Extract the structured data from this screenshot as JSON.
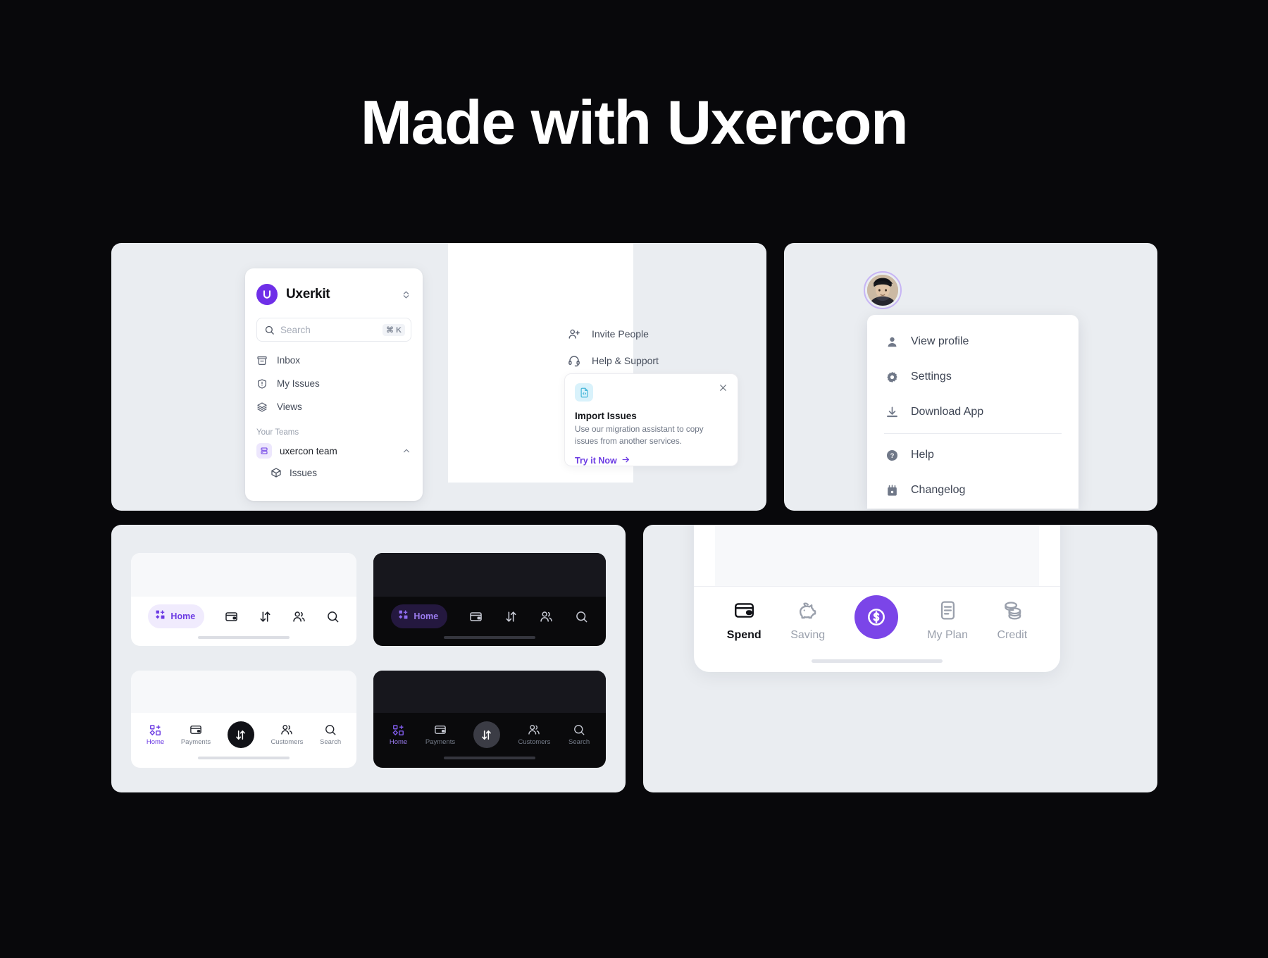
{
  "hero": {
    "title": "Made with Uxercon"
  },
  "colors": {
    "page_background": "#08080b",
    "card_background": "#eaedf1",
    "accent_purple": "#6b3ae3",
    "fab_purple": "#7b45e8",
    "dark_phone": "#0a0a0c"
  },
  "sidebar": {
    "brand": {
      "name": "Uxerkit",
      "logo_letter": "U",
      "switcher_icon": "chevron-up-down-icon"
    },
    "search": {
      "placeholder": "Search",
      "value": "",
      "shortcut": "⌘ K",
      "icon": "search-icon"
    },
    "nav": [
      {
        "label": "Inbox",
        "icon": "inbox-icon"
      },
      {
        "label": "My Issues",
        "icon": "shield-alert-icon"
      },
      {
        "label": "Views",
        "icon": "layers-icon"
      }
    ],
    "teams_label": "Your Teams",
    "team": {
      "label": "uxercon team",
      "icon": "server-icon",
      "chevron": "chevron-up-icon"
    },
    "team_children": [
      {
        "label": "Issues",
        "icon": "box-icon"
      }
    ]
  },
  "sidebar_footer": {
    "items": [
      {
        "label": "Invite People",
        "icon": "user-plus-icon"
      },
      {
        "label": "Help & Support",
        "icon": "headset-icon"
      }
    ]
  },
  "import_card": {
    "icon": "file-code-icon",
    "close_icon": "close-icon",
    "title": "Import Issues",
    "description": "Use our migration assistant to copy issues from another services.",
    "cta": "Try it Now",
    "cta_icon": "arrow-right-icon"
  },
  "profile_menu": {
    "avatar": "user-avatar",
    "items": [
      {
        "label": "View profile",
        "icon": "user-icon"
      },
      {
        "label": "Settings",
        "icon": "gear-icon"
      },
      {
        "label": "Download App",
        "icon": "download-icon"
      },
      {
        "label": "Help",
        "icon": "question-circle-icon"
      },
      {
        "label": "Changelog",
        "icon": "calendar-icon"
      }
    ],
    "separator_after_index": 2
  },
  "tabbars": {
    "pill_light": {
      "theme": "light",
      "active_label": "Home",
      "active_icon": "dashboard-icon",
      "items": [
        {
          "label": "Home",
          "icon": "dashboard-icon",
          "active": true
        },
        {
          "label": "Payments",
          "icon": "credit-card-icon",
          "active": false
        },
        {
          "label": "Transfer",
          "icon": "transfer-arrows-icon",
          "active": false
        },
        {
          "label": "Customers",
          "icon": "users-icon",
          "active": false
        },
        {
          "label": "Search",
          "icon": "search-icon",
          "active": false
        }
      ]
    },
    "pill_dark": {
      "theme": "dark",
      "active_label": "Home",
      "active_icon": "dashboard-icon",
      "items": [
        {
          "label": "Home",
          "icon": "dashboard-icon",
          "active": true
        },
        {
          "label": "Payments",
          "icon": "credit-card-icon",
          "active": false
        },
        {
          "label": "Transfer",
          "icon": "transfer-arrows-icon",
          "active": false
        },
        {
          "label": "Customers",
          "icon": "users-icon",
          "active": false
        },
        {
          "label": "Search",
          "icon": "search-icon",
          "active": false
        }
      ]
    },
    "labeled_light": {
      "theme": "light",
      "items": [
        {
          "label": "Home",
          "icon": "dashboard-icon",
          "active": true
        },
        {
          "label": "Payments",
          "icon": "credit-card-icon",
          "active": false
        },
        {
          "label": "",
          "icon": "transfer-arrows-icon",
          "active": false,
          "fab": true
        },
        {
          "label": "Customers",
          "icon": "users-icon",
          "active": false
        },
        {
          "label": "Search",
          "icon": "search-icon",
          "active": false
        }
      ]
    },
    "labeled_dark": {
      "theme": "dark",
      "items": [
        {
          "label": "Home",
          "icon": "dashboard-icon",
          "active": true
        },
        {
          "label": "Payments",
          "icon": "credit-card-icon",
          "active": false
        },
        {
          "label": "",
          "icon": "transfer-arrows-icon",
          "active": false,
          "fab": true
        },
        {
          "label": "Customers",
          "icon": "users-icon",
          "active": false
        },
        {
          "label": "Search",
          "icon": "search-icon",
          "active": false
        }
      ]
    },
    "finance": {
      "items": [
        {
          "label": "Spend",
          "icon": "credit-card-icon",
          "active": true
        },
        {
          "label": "Saving",
          "icon": "piggy-bank-icon",
          "active": false
        },
        {
          "label": "",
          "icon": "dollar-circle-icon",
          "active": false,
          "fab": true
        },
        {
          "label": "My Plan",
          "icon": "document-lines-icon",
          "active": false
        },
        {
          "label": "Credit",
          "icon": "coins-icon",
          "active": false
        }
      ]
    }
  }
}
